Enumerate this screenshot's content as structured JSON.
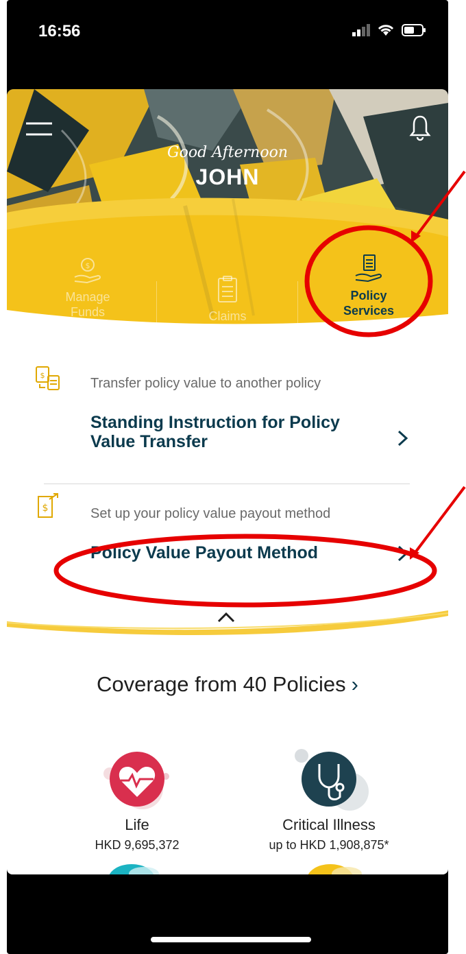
{
  "status_bar": {
    "time": "16:56"
  },
  "hero": {
    "greeting": "Good Afternoon",
    "user_name": "JOHN"
  },
  "nav": [
    {
      "line1": "Manage",
      "line2": "Funds"
    },
    {
      "line1": "",
      "line2": "Claims"
    },
    {
      "line1": "Policy",
      "line2": "Services"
    }
  ],
  "services": [
    {
      "description": "Transfer policy value to another policy",
      "title_line1": "Standing Instruction for Policy",
      "title_line2": "Value Transfer"
    },
    {
      "description": "Set up your policy value payout method",
      "title_line1": "Policy Value Payout Method",
      "title_line2": ""
    }
  ],
  "coverage": {
    "title": "Coverage from 40 Policies",
    "items": [
      {
        "name": "Life",
        "amount": "HKD 9,695,372",
        "icon": "heart-pulse-icon",
        "color": "#d92f4e"
      },
      {
        "name": "Critical Illness",
        "amount": "up to HKD 1,908,875*",
        "icon": "stethoscope-icon",
        "color": "#1e4250"
      }
    ]
  },
  "colors": {
    "brand_yellow": "#f4c21a",
    "navy": "#0b3a4d",
    "annotation_red": "#e60000"
  }
}
